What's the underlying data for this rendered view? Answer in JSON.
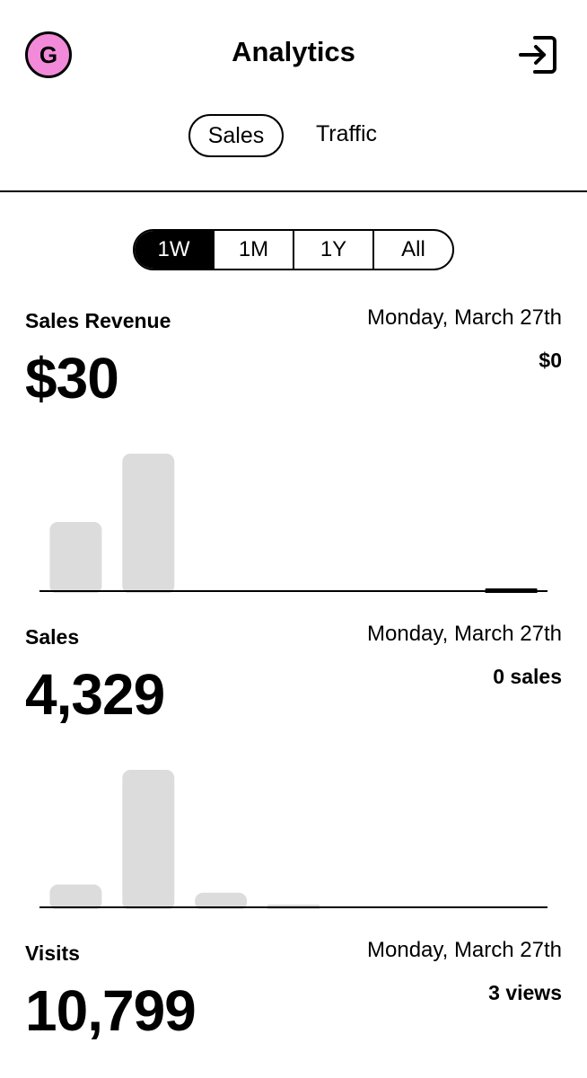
{
  "header": {
    "avatar_letter": "G",
    "title": "Analytics",
    "avatar_color": "#f28ad9"
  },
  "tabs": [
    {
      "label": "Sales",
      "active": true
    },
    {
      "label": "Traffic",
      "active": false
    }
  ],
  "range": {
    "options": [
      "1W",
      "1M",
      "1Y",
      "All"
    ],
    "selected": "1W"
  },
  "sections": {
    "revenue": {
      "label": "Sales Revenue",
      "date": "Monday, March 27th",
      "value": "$30",
      "detail": "$0"
    },
    "sales": {
      "label": "Sales",
      "date": "Monday, March 27th",
      "value": "4,329",
      "detail": "0 sales"
    },
    "visits": {
      "label": "Visits",
      "date": "Monday, March 27th",
      "value": "10,799",
      "detail": "3 views"
    }
  },
  "chart_data": [
    {
      "type": "bar",
      "series": [
        {
          "values": [
            0.5,
            1.0,
            0,
            0,
            0,
            0,
            0.005
          ]
        }
      ],
      "bar_color": "#dcdcdc",
      "selected_color": "#000000"
    },
    {
      "type": "bar",
      "series": [
        {
          "values": [
            0.16,
            1.0,
            0.1,
            0.01,
            0,
            0,
            0
          ]
        }
      ],
      "bar_color": "#dcdcdc"
    }
  ]
}
